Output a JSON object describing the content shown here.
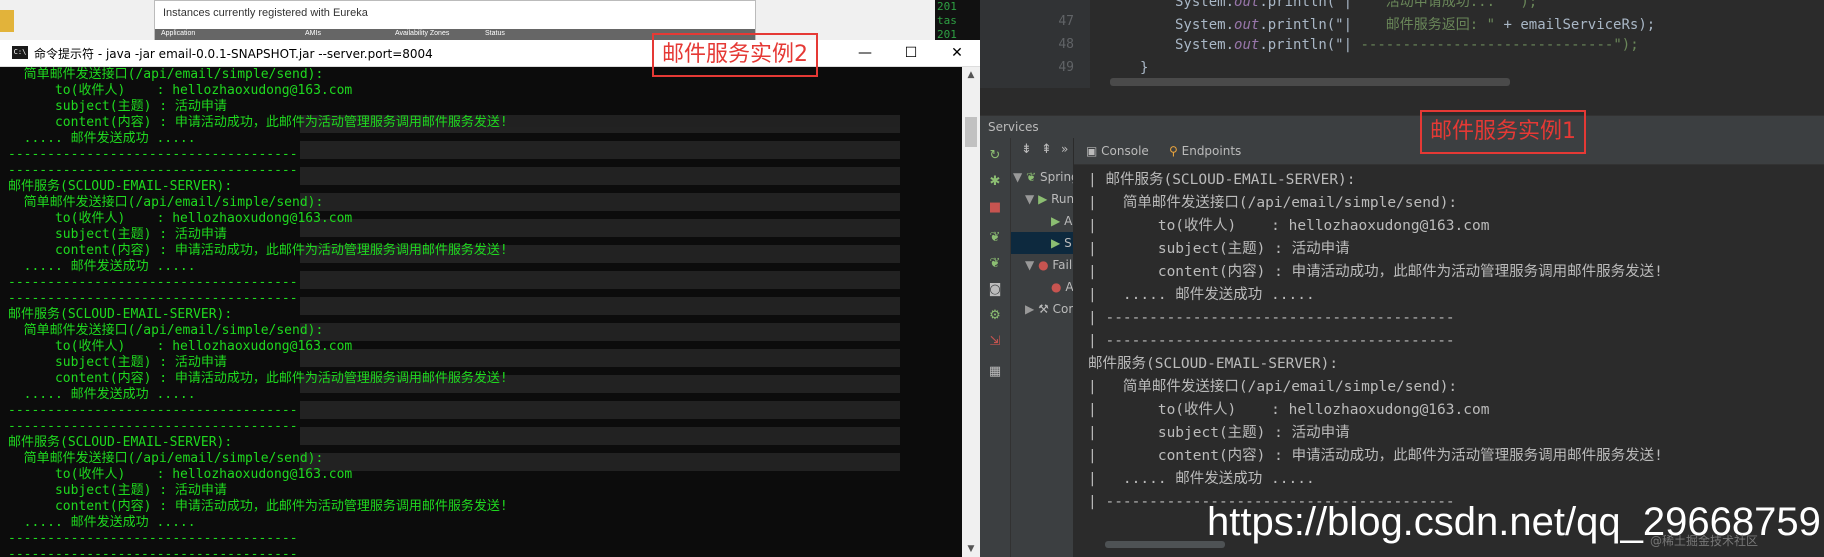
{
  "background": {
    "eureka_title": "Instances currently registered with Eureka",
    "eureka_columns": [
      "Application",
      "AMIs",
      "Availability Zones",
      "Status"
    ],
    "right_green_text": [
      "201",
      "tas",
      "201"
    ]
  },
  "cmd": {
    "icon_text": "C:\\",
    "title": "命令提示符 - java  -jar email-0.0.1-SNAPSHOT.jar --server.port=8004",
    "minimize": "—",
    "maximize": "☐",
    "close": "✕",
    "lines": [
      "  简单邮件发送接口(/api/email/simple/send):",
      "      to(收件人)    : hellozhaoxudong@163.com",
      "      subject(主题) : 活动申请",
      "      content(内容) : 申请活动成功，此邮件为活动管理服务调用邮件服务发送!",
      "  ..... 邮件发送成功 .....",
      "-------------------------------------",
      "-------------------------------------",
      "邮件服务(SCLOUD-EMAIL-SERVER):",
      "  简单邮件发送接口(/api/email/simple/send):",
      "      to(收件人)    : hellozhaoxudong@163.com",
      "      subject(主题) : 活动申请",
      "      content(内容) : 申请活动成功，此邮件为活动管理服务调用邮件服务发送!",
      "  ..... 邮件发送成功 .....",
      "-------------------------------------",
      "-------------------------------------",
      "邮件服务(SCLOUD-EMAIL-SERVER):",
      "  简单邮件发送接口(/api/email/simple/send):",
      "      to(收件人)    : hellozhaoxudong@163.com",
      "      subject(主题) : 活动申请",
      "      content(内容) : 申请活动成功，此邮件为活动管理服务调用邮件服务发送!",
      "  ..... 邮件发送成功 .....",
      "-------------------------------------",
      "-------------------------------------",
      "邮件服务(SCLOUD-EMAIL-SERVER):",
      "  简单邮件发送接口(/api/email/simple/send):",
      "      to(收件人)    : hellozhaoxudong@163.com",
      "      subject(主题) : 活动申请",
      "      content(内容) : 申请活动成功，此邮件为活动管理服务调用邮件服务发送!",
      "  ..... 邮件发送成功 .....",
      "-------------------------------------",
      "-------------------------------------"
    ]
  },
  "annotations": {
    "instance2": "邮件服务实例2",
    "instance1": "邮件服务实例1"
  },
  "editor": {
    "line_numbers": [
      "47",
      "48",
      "49"
    ],
    "lines": [
      {
        "pre": "System.",
        "kw": "out",
        "post": ".println(\"|    ",
        "str": "活动申请成功...  \");",
        "tail": ""
      },
      {
        "pre": "System.",
        "kw": "out",
        "post": ".println(\"|    ",
        "str": "邮件服务返回: \"",
        "tail": " + emailServiceRs);"
      },
      {
        "pre": "System.",
        "kw": "out",
        "post": ".println(\"| ",
        "str": "------------------------------\");",
        "tail": ""
      },
      {
        "pre": "}",
        "kw": "",
        "post": "",
        "str": "",
        "tail": ""
      }
    ]
  },
  "services": {
    "label": "Services",
    "console_tab": "Console",
    "endpoints_tab": "Endpoints",
    "tree": [
      {
        "label": "Spring",
        "icon": "spring-icon"
      },
      {
        "label": "Run",
        "icon": "run-icon"
      },
      {
        "label": "A",
        "icon": "app-icon"
      },
      {
        "label": "S",
        "icon": "app-icon"
      },
      {
        "label": "Faile",
        "icon": "error-icon"
      },
      {
        "label": "A",
        "icon": "app-icon"
      },
      {
        "label": "Con",
        "icon": "wrench-icon"
      }
    ],
    "console_lines": [
      "| 邮件服务(SCLOUD-EMAIL-SERVER):",
      "|   简单邮件发送接口(/api/email/simple/send):",
      "|       to(收件人)    : hellozhaoxudong@163.com",
      "|       subject(主题) : 活动申请",
      "|       content(内容) : 申请活动成功，此邮件为活动管理服务调用邮件服务发送!",
      "|   ..... 邮件发送成功 .....",
      "| ----------------------------------------",
      "| ----------------------------------------",
      "邮件服务(SCLOUD-EMAIL-SERVER):",
      "|   简单邮件发送接口(/api/email/simple/send):",
      "|       to(收件人)    : hellozhaoxudong@163.com",
      "|       subject(主题) : 活动申请",
      "|       content(内容) : 申请活动成功，此邮件为活动管理服务调用邮件服务发送!",
      "|   ..... 邮件发送成功 .....",
      "| ----------------------------------------"
    ]
  },
  "watermark": "https://blog.csdn.net/qq_29668759",
  "watermark_small": "@稀土掘金技术社区"
}
